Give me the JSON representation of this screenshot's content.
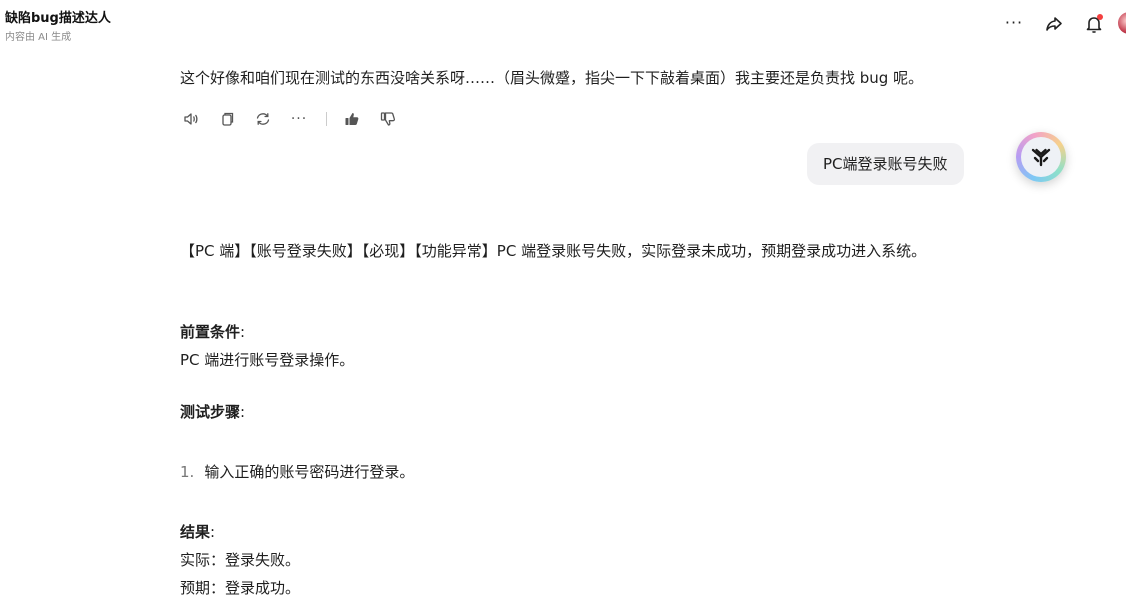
{
  "header": {
    "title": "缺陷bug描述达人",
    "subtitle": "内容由 AI 生成",
    "more_glyph": "···"
  },
  "conversation": {
    "previous_bot_message": "这个好像和咱们现在测试的东西没啥关系呀……（眉头微蹙，指尖一下下敲着桌面）我主要还是负责找 bug 呢。",
    "user_message": "PC端登录账号失败",
    "actions_more_glyph": "···"
  },
  "reply": {
    "summary": "【PC 端】【账号登录失败】【必现】【功能异常】PC 端登录账号失败，实际登录未成功，预期登录成功进入系统。",
    "precondition_title": "前置条件",
    "precondition_text": "PC 端进行账号登录操作。",
    "steps_title": "测试步骤",
    "steps": [
      {
        "num": "1.",
        "text": "输入正确的账号密码进行登录。"
      }
    ],
    "result_title": "结果",
    "actual": "实际：登录失败。",
    "expected": "预期：登录成功。"
  },
  "icons": {
    "header": [
      "more-icon",
      "share-icon",
      "bell-icon",
      "avatar"
    ],
    "actions": [
      "speaker-icon",
      "copy-icon",
      "regenerate-icon",
      "more-icon",
      "thumbs-up-icon",
      "thumbs-down-icon"
    ],
    "floating": "assistant-logo-icon"
  },
  "colors": {
    "notification_dot": "#f43f3f",
    "user_bubble_bg": "#f1f1f3"
  }
}
